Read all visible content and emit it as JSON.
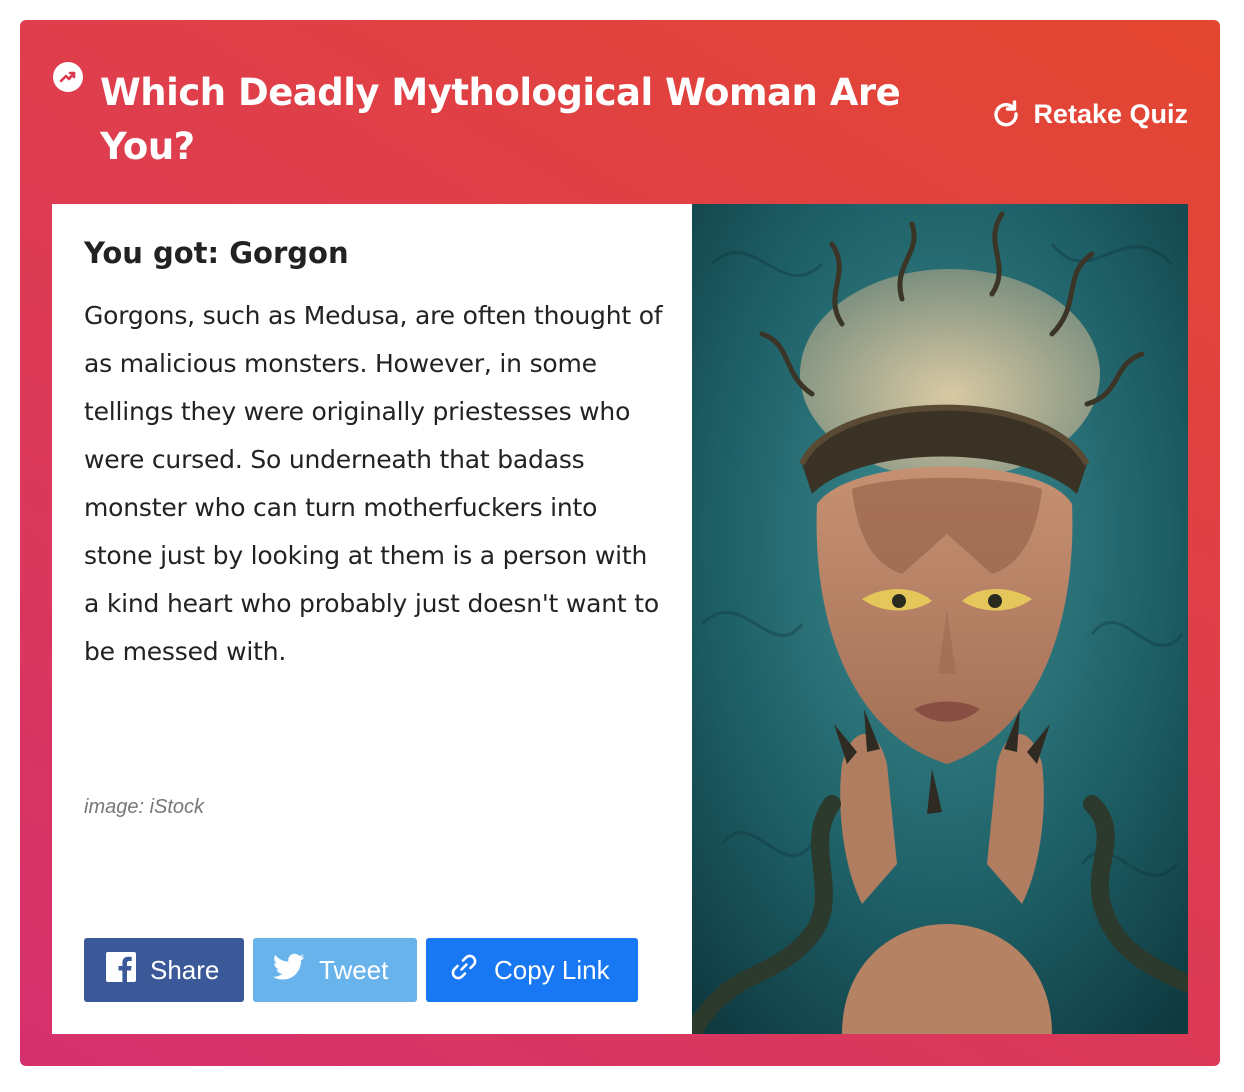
{
  "quiz": {
    "title": "Which Deadly Mythological Woman Are You?",
    "retake_label": "Retake Quiz"
  },
  "result": {
    "heading": "You got: Gorgon",
    "description": "Gorgons, such as Medusa, are often thought of as malicious monsters. However, in some tellings they were originally priestesses who were cursed. So underneath that badass monster who can turn motherfuckers into stone just by looking at them is a person with a kind heart who probably just doesn't want to be messed with.",
    "image_credit": "image: iStock"
  },
  "share": {
    "facebook_label": "Share",
    "twitter_label": "Tweet",
    "copy_label": "Copy Link"
  },
  "icons": [
    "trending-icon",
    "refresh-icon",
    "facebook-icon",
    "twitter-icon",
    "link-icon"
  ],
  "colors": {
    "card_gradient_start": "#d5306d",
    "card_gradient_end": "#e4472f",
    "facebook": "#3b5998",
    "twitter": "#69b3ec",
    "copy_link": "#1877f2"
  }
}
